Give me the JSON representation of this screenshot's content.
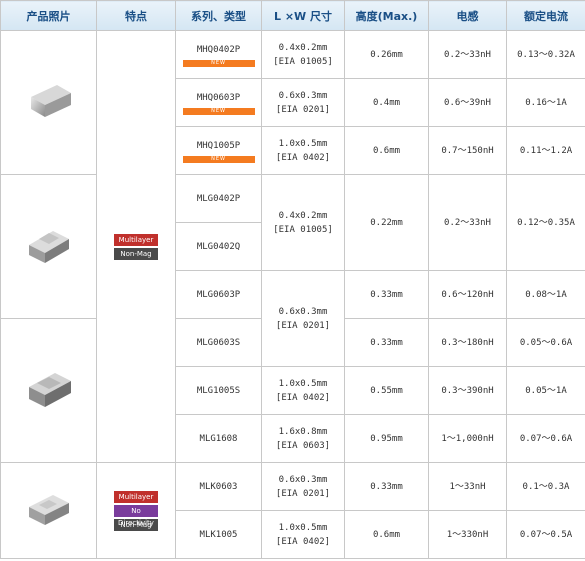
{
  "headers": [
    "产品照片",
    "特点",
    "系列、类型",
    "L ×W 尺寸",
    "高度(Max.)",
    "电感",
    "额定电流"
  ],
  "new_label": "NEW",
  "features": {
    "group1": [
      {
        "label": "Multilayer",
        "color": "#c0302c"
      },
      {
        "label": "Non-Mag Core",
        "color": "#4a4a4a"
      }
    ],
    "group2": [
      {
        "label": "Multilayer",
        "color": "#c0302c"
      },
      {
        "label": "No Directivity",
        "color": "#7a3c9c"
      },
      {
        "label": "Non-Mag Core",
        "color": "#4a4a4a"
      }
    ]
  },
  "rows": [
    {
      "type": "MHQ0402P",
      "size": [
        "0.4x0.2mm",
        "[EIA 01005]"
      ],
      "height": "0.26mm",
      "inductance": "0.2～33nH",
      "current": "0.13～0.32A"
    },
    {
      "type": "MHQ0603P",
      "size": [
        "0.6x0.3mm",
        "[EIA 0201]"
      ],
      "height": "0.4mm",
      "inductance": "0.6～39nH",
      "current": "0.16～1A"
    },
    {
      "type": "MHQ1005P",
      "size": [
        "1.0x0.5mm",
        "[EIA 0402]"
      ],
      "height": "0.6mm",
      "inductance": "0.7～150nH",
      "current": "0.11～1.2A"
    },
    {
      "type": "MLG0402P"
    },
    {
      "type": "MLG0402Q"
    },
    {
      "type": "MLG0603P",
      "height": "0.33mm",
      "inductance": "0.6～120nH",
      "current": "0.08～1A"
    },
    {
      "type": "MLG0603S",
      "height": "0.33mm",
      "inductance": "0.3～180nH",
      "current": "0.05～0.6A"
    },
    {
      "type": "MLG1005S",
      "size": [
        "1.0x0.5mm",
        "[EIA 0402]"
      ],
      "height": "0.55mm",
      "inductance": "0.3～390nH",
      "current": "0.05～1A"
    },
    {
      "type": "MLG1608",
      "size": [
        "1.6x0.8mm",
        "[EIA 0603]"
      ],
      "height": "0.95mm",
      "inductance": "1～1,000nH",
      "current": "0.07～0.6A"
    },
    {
      "type": "MLK0603",
      "size": [
        "0.6x0.3mm",
        "[EIA 0201]"
      ],
      "height": "0.33mm",
      "inductance": "1～33nH",
      "current": "0.1～0.3A"
    },
    {
      "type": "MLK1005",
      "size": [
        "1.0x0.5mm",
        "[EIA 0402]"
      ],
      "height": "0.6mm",
      "inductance": "1～330nH",
      "current": "0.07～0.5A"
    }
  ],
  "merged": {
    "mlg0402": {
      "size": [
        "0.4x0.2mm",
        "[EIA 01005]"
      ],
      "height": "0.22mm",
      "inductance": "0.2～33nH",
      "current": "0.12～0.35A"
    },
    "mlg0603": {
      "size": [
        "0.6x0.3mm",
        "[EIA 0201]"
      ]
    }
  }
}
